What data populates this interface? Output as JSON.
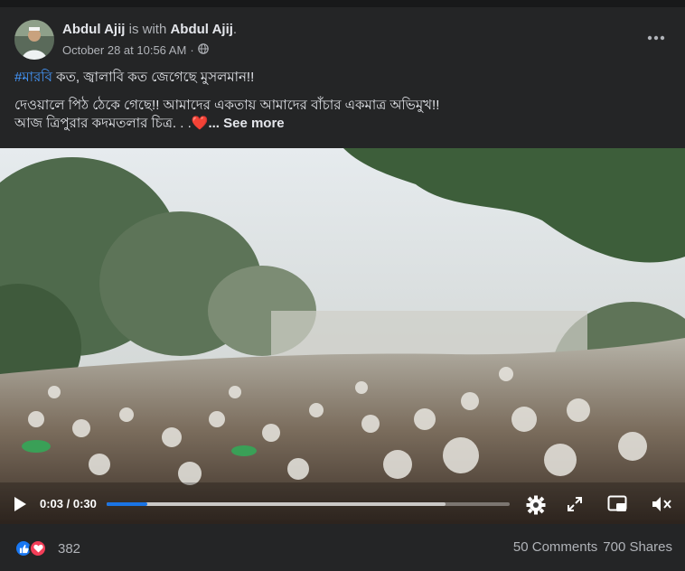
{
  "post": {
    "author": "Abdul Ajij",
    "with_text": "is with",
    "tagged": "Abdul Ajij",
    "period": ".",
    "timestamp": "October 28 at 10:56 AM",
    "separator": "·",
    "audience_icon": "globe-icon",
    "more_icon": "more-horizontal-icon",
    "hashtag": "#মারবি",
    "line1_rest": " কত, জ্বালাবি কত জেগেছে মুসলমান!!",
    "line2": "দেওয়ালে পিঠ ঠেকে গেছে!! আমাদের একতায় আমাদের বাঁচার একমাত্র অভিমুখ!!",
    "line3": "আজ ত্রিপুরার কদমতলার চিত্র. . .",
    "heart_emoji": "❤️",
    "see_more": "... See more"
  },
  "video": {
    "current_time": "0:03",
    "duration": "0:30",
    "time_sep": " / ",
    "progress": 0.1,
    "buffered": 0.84,
    "accent": "#1b74e4",
    "icons": [
      "play-icon",
      "settings-icon",
      "fullscreen-icon",
      "picture-in-picture-icon",
      "volume-muted-icon"
    ]
  },
  "engagement": {
    "reaction_count": "382",
    "comments": "50 Comments",
    "shares": "700 Shares",
    "like_color": "#1877f2",
    "love_color": "#f33e58"
  }
}
